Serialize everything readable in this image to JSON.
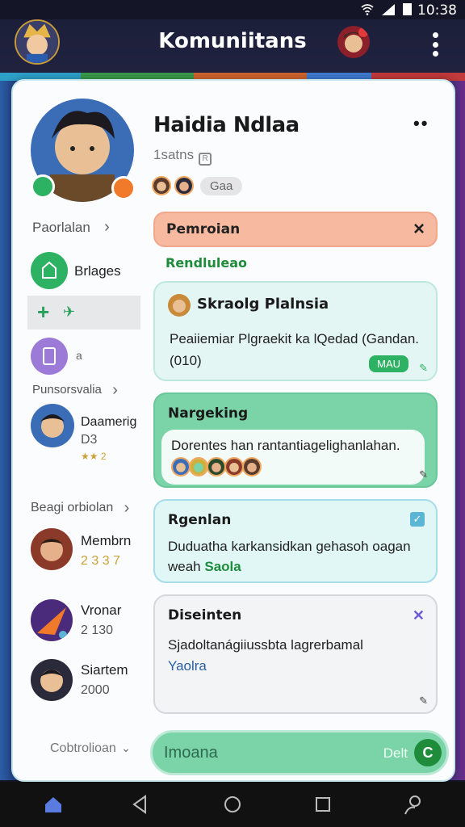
{
  "status_bar": {
    "time": "10:38"
  },
  "app_bar": {
    "title": "Komuniitans"
  },
  "profile": {
    "name": "Haidia Ndlaa",
    "subtitle": "1satns",
    "tag_glyph": "R",
    "chip": "Gaa",
    "more": "••"
  },
  "left": {
    "section1": "Paorlalan",
    "item_home": "Brlages",
    "item_extra": "a",
    "section2": "Punsorsvalia",
    "user1": {
      "name": "Daamerig",
      "sub": "D3",
      "stars": "★★ 2"
    },
    "section3": "Beagi orbiolan",
    "user2": {
      "name": "Membrn",
      "score": "2 3 3 7"
    },
    "user3": {
      "name": "Vronar",
      "score": "2 130"
    },
    "user4": {
      "name": "Siartem",
      "score": "2000"
    },
    "section4": "Cobtrolioan"
  },
  "alert": {
    "label": "Pemroian",
    "close": "×"
  },
  "green_label": "Rendluleao",
  "panel1": {
    "title": "Skraolg Plalnsia",
    "body": "Peaiiemiar Plgraekit ka lQedad (Gandan. (010)",
    "badge": "MAU"
  },
  "panel2": {
    "title": "Nargeking",
    "body": "Dorentes han rantantiagelighanlahan."
  },
  "panel3": {
    "title": "Rgenlan",
    "body": "Duduatha karkansidkan gehasoh oagan weah",
    "highlight": "Saola",
    "check": "✓"
  },
  "panel4": {
    "title": "Diseinten",
    "body": "Sjadoltanágiiussbta lagrerbamal",
    "link": "Yaolra"
  },
  "compose": {
    "placeholder": "Imoana",
    "send_label": "Delt",
    "send_glyph": "C"
  },
  "colors": {
    "accent_green": "#1f8c3b",
    "panel_mint": "#7bd3a8",
    "alert_salmon": "#f7b9a0",
    "appbar": "#1c1f3a"
  },
  "icons": [
    "home-icon",
    "back-icon",
    "circle-home-icon",
    "recents-icon",
    "user-search-icon",
    "kebab-icon",
    "close-icon",
    "check-icon"
  ]
}
